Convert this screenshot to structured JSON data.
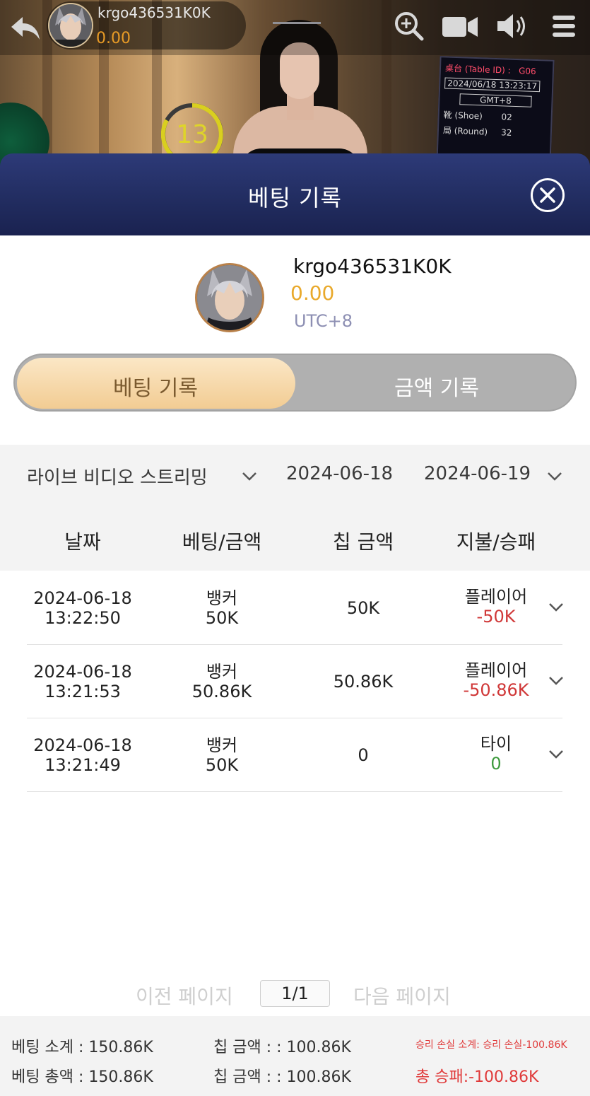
{
  "game": {
    "user_name": "krgo436531K0K",
    "balance": "0.00",
    "timer": "13",
    "info_panel": {
      "table_label": "桌台 (Table ID) :",
      "table_id": "G06",
      "datetime": "2024/06/18 13:23:17",
      "timezone": "GMT+8",
      "shoe_label": "靴 (Shoe)",
      "shoe_value": "02",
      "round_label": "局 (Round)",
      "round_value": "32"
    },
    "icons": [
      "back-arrow-icon",
      "zoom-in-icon",
      "video-camera-icon",
      "speaker-icon",
      "menu-icon"
    ]
  },
  "modal": {
    "title": "베팅 기록",
    "profile": {
      "name": "krgo436531K0K",
      "balance": "0.00",
      "timezone": "UTC+8"
    },
    "tabs": [
      {
        "label": "베팅 기록",
        "active": true
      },
      {
        "label": "금액 기록",
        "active": false
      }
    ],
    "filters": {
      "category": "라이브 비디오 스트리밍",
      "date_from": "2024-06-18",
      "date_to": "2024-06-19"
    },
    "columns": [
      "날짜",
      "베팅/금액",
      "칩 금액",
      "지불/승패"
    ],
    "rows": [
      {
        "date": "2024-06-18",
        "time": "13:22:50",
        "bet_type": "뱅커",
        "bet_amount": "50K",
        "chip": "50K",
        "result": "플레이어",
        "win_loss": "-50K"
      },
      {
        "date": "2024-06-18",
        "time": "13:21:53",
        "bet_type": "뱅커",
        "bet_amount": "50.86K",
        "chip": "50.86K",
        "result": "플레이어",
        "win_loss": "-50.86K"
      },
      {
        "date": "2024-06-18",
        "time": "13:21:49",
        "bet_type": "뱅커",
        "bet_amount": "50K",
        "chip": "0",
        "result": "타이",
        "win_loss": "0"
      }
    ],
    "pager": {
      "prev": "이전 페이지",
      "current": "1/1",
      "next": "다음 페이지"
    },
    "summary": {
      "bet_subtotal": "베팅 소계 : 150.86K",
      "chip_subtotal": "칩 금액 : : 100.86K",
      "winloss_subtotal": "승리 손실 소계: 승리 손실-100.86K",
      "bet_total": "베팅 총액 : 150.86K",
      "chip_total": "칩 금액 : : 100.86K",
      "winloss_total": "총 승패:-100.86K"
    }
  },
  "colors": {
    "header_navy": "#212c5f",
    "gold_balance": "#e9a92b",
    "loss_red": "#d03838",
    "tie_green": "#3d9a3d",
    "tab_active": "#f2cc93"
  }
}
